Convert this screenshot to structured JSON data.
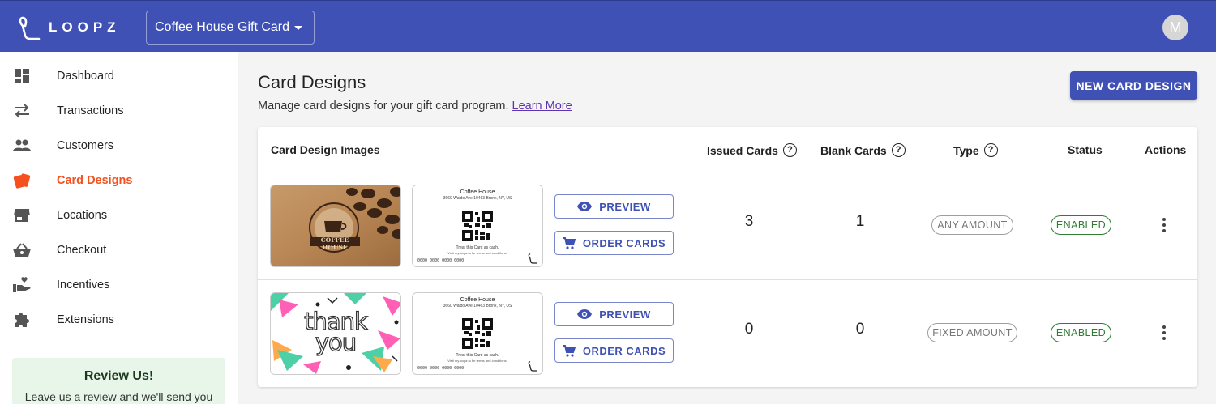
{
  "header": {
    "brand": "LOOPZ",
    "program_selected": "Coffee House Gift Card",
    "avatar_initial": "M"
  },
  "sidebar": {
    "items": [
      {
        "label": "Dashboard",
        "icon": "dashboard-icon"
      },
      {
        "label": "Transactions",
        "icon": "swap-arrows-icon"
      },
      {
        "label": "Customers",
        "icon": "people-icon"
      },
      {
        "label": "Card Designs",
        "icon": "cards-icon",
        "active": true
      },
      {
        "label": "Locations",
        "icon": "store-icon"
      },
      {
        "label": "Checkout",
        "icon": "basket-icon"
      },
      {
        "label": "Incentives",
        "icon": "hand-heart-icon"
      },
      {
        "label": "Extensions",
        "icon": "puzzle-icon"
      }
    ],
    "review": {
      "title": "Review Us!",
      "text": "Leave us a review and we'll send you"
    }
  },
  "main": {
    "title": "Card Designs",
    "subtitle": "Manage card designs for your gift card program.",
    "learn_more": "Learn More",
    "new_button": "NEW CARD DESIGN"
  },
  "table": {
    "headers": {
      "images": "Card Design Images",
      "issued": "Issued Cards",
      "blank": "Blank Cards",
      "type": "Type",
      "status": "Status",
      "actions": "Actions"
    },
    "preview_label": "PREVIEW",
    "order_label": "ORDER CARDS",
    "card_back": {
      "name": "Coffee House",
      "address": "3660 Waldo Ave 10463 Bronx, NY, US",
      "treat": "Treat this Card as cash.",
      "visit": "Visit my.loopz.io for terms and conditions.",
      "number": "0000 0000 0000 0000"
    },
    "rows": [
      {
        "front_text": "COFFEE HOUSE",
        "issued": "3",
        "blank": "1",
        "type": "ANY AMOUNT",
        "status": "ENABLED"
      },
      {
        "front_text": "thank you",
        "issued": "0",
        "blank": "0",
        "type": "FIXED AMOUNT",
        "status": "ENABLED"
      }
    ]
  },
  "colors": {
    "primary": "#3f51b5",
    "active_nav": "#f4511e",
    "enabled": "#2e7d32"
  }
}
